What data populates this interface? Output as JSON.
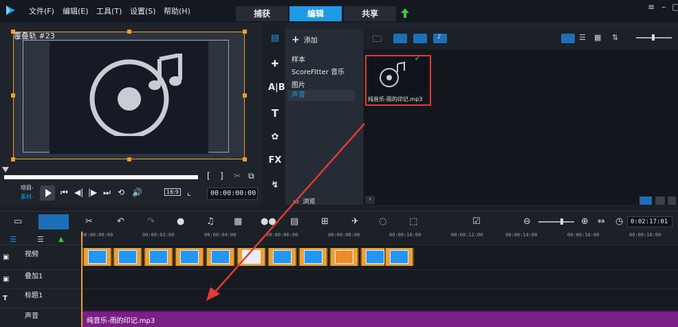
{
  "menu": {
    "file": "文件(F)",
    "edit": "编辑(E)",
    "tools": "工具(T)",
    "settings": "设置(S)",
    "help": "帮助(H)"
  },
  "mode_tabs": [
    {
      "label": "捕获",
      "active": false
    },
    {
      "label": "编辑",
      "active": true
    },
    {
      "label": "共享",
      "active": false
    }
  ],
  "player": {
    "track_label": "覆叠轨 #23",
    "project_label": "项目-",
    "clip_label": "素材-",
    "aspect": "16:9",
    "bracket_in": "[",
    "bracket_out": "]",
    "timecode": "00:00:00:00"
  },
  "library": {
    "add_label": "添加",
    "categories": [
      "样本",
      "ScoreFitter 音乐",
      "图片",
      "声音"
    ],
    "active_category": "声音",
    "browse_label": "浏览",
    "side_icons": [
      "FX"
    ],
    "item": {
      "name": "纯音乐-雨的印记.mp3",
      "selected": true
    }
  },
  "timeline": {
    "zoom_timecode": "0:02:17:01",
    "ruler_ticks": [
      "00:00:00:00",
      "00:00:02:00",
      "00:00:04:00",
      "00:00:06:00",
      "00:00:08:00",
      "00:00:10:00",
      "00:00:12:00",
      "00:00:14:00",
      "00:00:16:00",
      "00:00:18:00"
    ],
    "tracks": [
      {
        "name": "视频"
      },
      {
        "name": "叠加1"
      },
      {
        "name": "标题1"
      },
      {
        "name": "声音"
      }
    ],
    "audio_clip": "纯音乐-雨的印记.mp3"
  },
  "colors": {
    "accent": "#1d9be6",
    "selection": "#e53935",
    "audio_clip": "#7a1f86",
    "video_clip": "#e8a23a"
  }
}
